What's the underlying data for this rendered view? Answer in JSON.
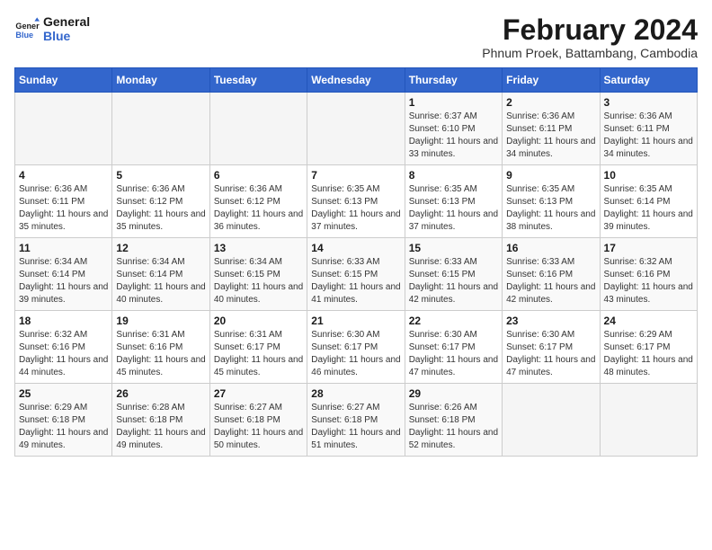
{
  "logo": {
    "line1": "General",
    "line2": "Blue"
  },
  "title": "February 2024",
  "subtitle": "Phnum Proek, Battambang, Cambodia",
  "weekdays": [
    "Sunday",
    "Monday",
    "Tuesday",
    "Wednesday",
    "Thursday",
    "Friday",
    "Saturday"
  ],
  "weeks": [
    [
      {
        "day": "",
        "info": ""
      },
      {
        "day": "",
        "info": ""
      },
      {
        "day": "",
        "info": ""
      },
      {
        "day": "",
        "info": ""
      },
      {
        "day": "1",
        "info": "Sunrise: 6:37 AM\nSunset: 6:10 PM\nDaylight: 11 hours and 33 minutes."
      },
      {
        "day": "2",
        "info": "Sunrise: 6:36 AM\nSunset: 6:11 PM\nDaylight: 11 hours and 34 minutes."
      },
      {
        "day": "3",
        "info": "Sunrise: 6:36 AM\nSunset: 6:11 PM\nDaylight: 11 hours and 34 minutes."
      }
    ],
    [
      {
        "day": "4",
        "info": "Sunrise: 6:36 AM\nSunset: 6:11 PM\nDaylight: 11 hours and 35 minutes."
      },
      {
        "day": "5",
        "info": "Sunrise: 6:36 AM\nSunset: 6:12 PM\nDaylight: 11 hours and 35 minutes."
      },
      {
        "day": "6",
        "info": "Sunrise: 6:36 AM\nSunset: 6:12 PM\nDaylight: 11 hours and 36 minutes."
      },
      {
        "day": "7",
        "info": "Sunrise: 6:35 AM\nSunset: 6:13 PM\nDaylight: 11 hours and 37 minutes."
      },
      {
        "day": "8",
        "info": "Sunrise: 6:35 AM\nSunset: 6:13 PM\nDaylight: 11 hours and 37 minutes."
      },
      {
        "day": "9",
        "info": "Sunrise: 6:35 AM\nSunset: 6:13 PM\nDaylight: 11 hours and 38 minutes."
      },
      {
        "day": "10",
        "info": "Sunrise: 6:35 AM\nSunset: 6:14 PM\nDaylight: 11 hours and 39 minutes."
      }
    ],
    [
      {
        "day": "11",
        "info": "Sunrise: 6:34 AM\nSunset: 6:14 PM\nDaylight: 11 hours and 39 minutes."
      },
      {
        "day": "12",
        "info": "Sunrise: 6:34 AM\nSunset: 6:14 PM\nDaylight: 11 hours and 40 minutes."
      },
      {
        "day": "13",
        "info": "Sunrise: 6:34 AM\nSunset: 6:15 PM\nDaylight: 11 hours and 40 minutes."
      },
      {
        "day": "14",
        "info": "Sunrise: 6:33 AM\nSunset: 6:15 PM\nDaylight: 11 hours and 41 minutes."
      },
      {
        "day": "15",
        "info": "Sunrise: 6:33 AM\nSunset: 6:15 PM\nDaylight: 11 hours and 42 minutes."
      },
      {
        "day": "16",
        "info": "Sunrise: 6:33 AM\nSunset: 6:16 PM\nDaylight: 11 hours and 42 minutes."
      },
      {
        "day": "17",
        "info": "Sunrise: 6:32 AM\nSunset: 6:16 PM\nDaylight: 11 hours and 43 minutes."
      }
    ],
    [
      {
        "day": "18",
        "info": "Sunrise: 6:32 AM\nSunset: 6:16 PM\nDaylight: 11 hours and 44 minutes."
      },
      {
        "day": "19",
        "info": "Sunrise: 6:31 AM\nSunset: 6:16 PM\nDaylight: 11 hours and 45 minutes."
      },
      {
        "day": "20",
        "info": "Sunrise: 6:31 AM\nSunset: 6:17 PM\nDaylight: 11 hours and 45 minutes."
      },
      {
        "day": "21",
        "info": "Sunrise: 6:30 AM\nSunset: 6:17 PM\nDaylight: 11 hours and 46 minutes."
      },
      {
        "day": "22",
        "info": "Sunrise: 6:30 AM\nSunset: 6:17 PM\nDaylight: 11 hours and 47 minutes."
      },
      {
        "day": "23",
        "info": "Sunrise: 6:30 AM\nSunset: 6:17 PM\nDaylight: 11 hours and 47 minutes."
      },
      {
        "day": "24",
        "info": "Sunrise: 6:29 AM\nSunset: 6:17 PM\nDaylight: 11 hours and 48 minutes."
      }
    ],
    [
      {
        "day": "25",
        "info": "Sunrise: 6:29 AM\nSunset: 6:18 PM\nDaylight: 11 hours and 49 minutes."
      },
      {
        "day": "26",
        "info": "Sunrise: 6:28 AM\nSunset: 6:18 PM\nDaylight: 11 hours and 49 minutes."
      },
      {
        "day": "27",
        "info": "Sunrise: 6:27 AM\nSunset: 6:18 PM\nDaylight: 11 hours and 50 minutes."
      },
      {
        "day": "28",
        "info": "Sunrise: 6:27 AM\nSunset: 6:18 PM\nDaylight: 11 hours and 51 minutes."
      },
      {
        "day": "29",
        "info": "Sunrise: 6:26 AM\nSunset: 6:18 PM\nDaylight: 11 hours and 52 minutes."
      },
      {
        "day": "",
        "info": ""
      },
      {
        "day": "",
        "info": ""
      }
    ]
  ]
}
